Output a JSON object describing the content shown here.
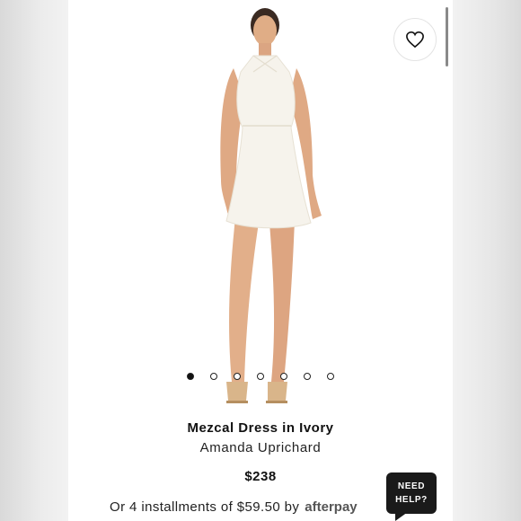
{
  "product": {
    "title": "Mezcal Dress in Ivory",
    "brand": "Amanda Uprichard",
    "price": "$238",
    "installments_text": "Or 4 installments of $59.50 by",
    "afterpay_logo": "afterpay"
  },
  "carousel": {
    "count": 7,
    "active_index": 0
  },
  "help_button": {
    "line1": "NEED",
    "line2": "HELP?"
  },
  "icons": {
    "favorite": "heart-icon"
  },
  "colors": {
    "dress": "#f6f3ec",
    "skin": "#e0ad86",
    "hair": "#3a2a22",
    "accent": "#111111"
  }
}
